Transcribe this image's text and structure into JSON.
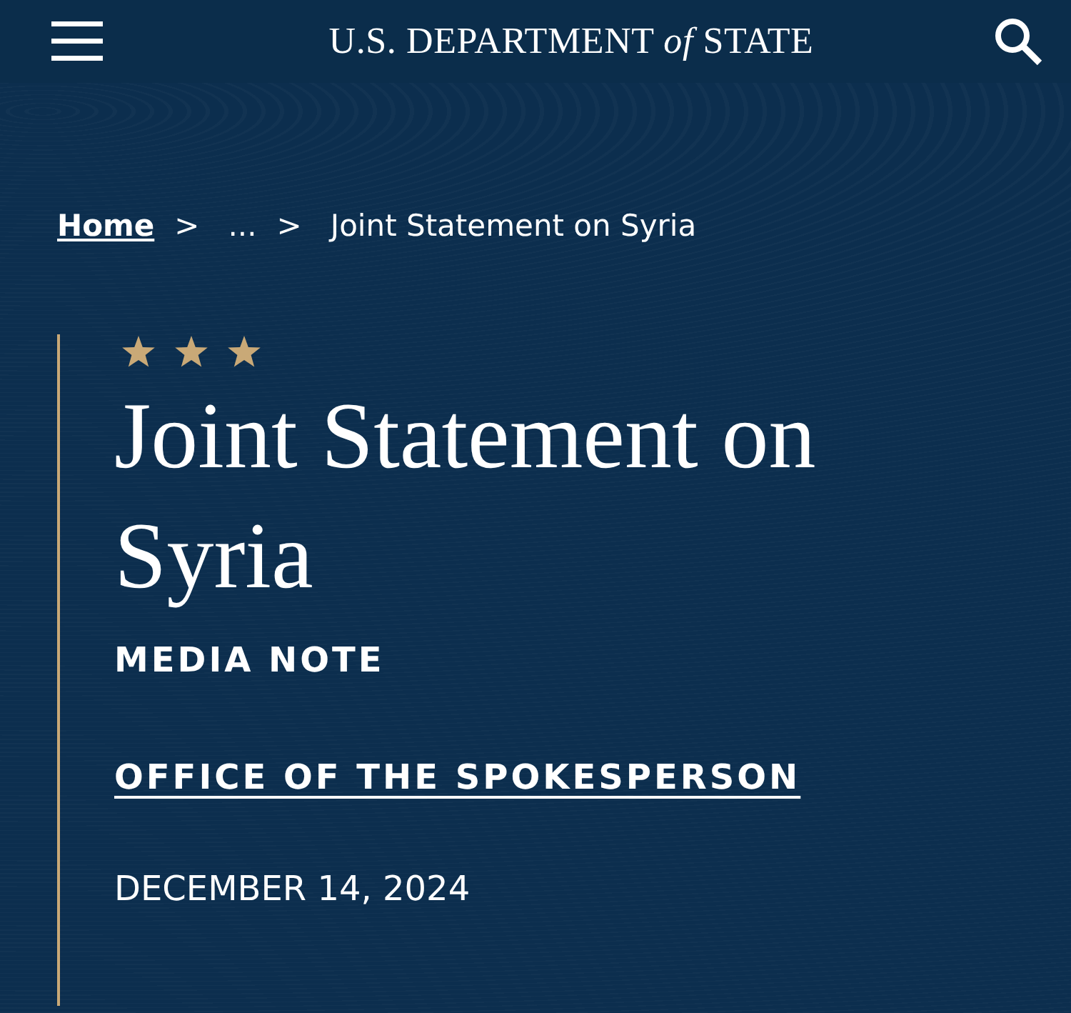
{
  "header": {
    "logo": "U.S. DEPARTMENT *of* STATE"
  },
  "breadcrumb_separator": ">",
  "breadcrumb": [
    {
      "label": "Home",
      "kind": "link"
    },
    {
      "label": "...",
      "kind": "text"
    },
    {
      "label": "Joint Statement on Syria",
      "kind": "text"
    }
  ],
  "article": {
    "title": "Joint Statement on Syria",
    "type": "MEDIA NOTE",
    "office": "OFFICE OF THE SPOKESPERSON",
    "date": "DECEMBER 14, 2024"
  }
}
